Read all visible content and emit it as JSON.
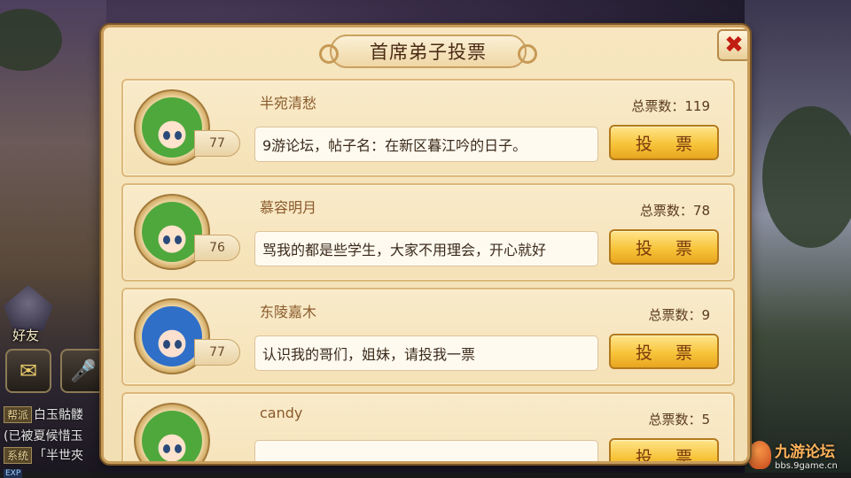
{
  "dialog": {
    "title": "首席弟子投票",
    "close_icon": "close-icon",
    "vote_label": "投 票",
    "candidates": [
      {
        "name": "半宛清愁",
        "level": "77",
        "message": "9游论坛，帖子名：在新区暮江吟的日子。",
        "votes": "总票数：119",
        "avatar": "green"
      },
      {
        "name": "慕容明月",
        "level": "76",
        "message": "骂我的都是些学生，大家不用理会，开心就好",
        "votes": "总票数：78",
        "avatar": "green"
      },
      {
        "name": "东陵嘉木",
        "level": "77",
        "message": "认识我的哥们，姐妹，请投我一票",
        "votes": "总票数：9",
        "avatar": "blue"
      },
      {
        "name": "candy",
        "level": "",
        "message": "",
        "votes": "总票数：5",
        "avatar": "green"
      }
    ]
  },
  "hud": {
    "friends_label": "好友",
    "chat_lines": [
      {
        "tag": "帮派",
        "text": "白玉骷髅"
      },
      {
        "tag": "",
        "text": "(已被夏候惜玉"
      },
      {
        "tag": "系统",
        "text": "「半世夾"
      }
    ],
    "exp_label": "EXP"
  },
  "watermark": {
    "title": "九游论坛",
    "url": "bbs.9game.cn"
  }
}
